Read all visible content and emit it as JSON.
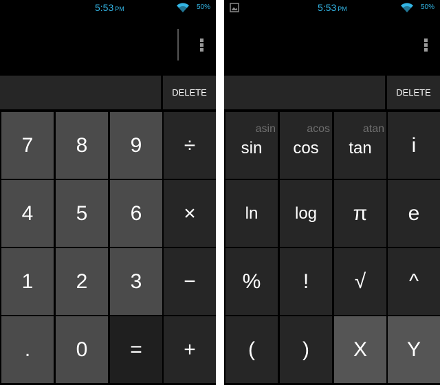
{
  "left": {
    "status": {
      "time": "5:53",
      "ampm": "PM",
      "battery": "50%"
    },
    "delete_label": "DELETE",
    "keys": {
      "k7": "7",
      "k8": "8",
      "k9": "9",
      "div": "÷",
      "k4": "4",
      "k5": "5",
      "k6": "6",
      "mul": "×",
      "k1": "1",
      "k2": "2",
      "k3": "3",
      "minus": "−",
      "dot": ".",
      "k0": "0",
      "eq": "=",
      "plus": "+"
    }
  },
  "right": {
    "status": {
      "time": "5:53",
      "ampm": "PM",
      "battery": "50%"
    },
    "delete_label": "DELETE",
    "keys": {
      "sin": "sin",
      "asin": "asin",
      "cos": "cos",
      "acos": "acos",
      "tan": "tan",
      "atan": "atan",
      "i": "i",
      "ln": "ln",
      "log": "log",
      "pi": "π",
      "e": "e",
      "percent": "%",
      "fact": "!",
      "sqrt": "√",
      "pow": "^",
      "lparen": "(",
      "rparen": ")",
      "x": "X",
      "y": "Y"
    }
  },
  "colors": {
    "status_accent": "#33b5e5",
    "digit_key": "#4b4b4b",
    "operator_key": "#262626",
    "highlight_key": "#555555",
    "background": "#000000"
  },
  "icons": {
    "wifi": "wifi-icon",
    "image_notification": "image-icon",
    "overflow": "overflow-menu-icon"
  }
}
